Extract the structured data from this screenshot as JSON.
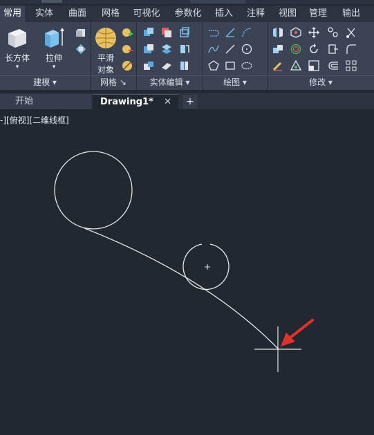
{
  "ribbon_tabs": [
    "常用",
    "实体",
    "曲面",
    "网格",
    "可视化",
    "参数化",
    "插入",
    "注释",
    "视图",
    "管理",
    "输出"
  ],
  "panels": {
    "modeling": {
      "title": "建模",
      "box_label": "长方体",
      "extrude_label": "拉伸"
    },
    "mesh": {
      "title": "网格",
      "smooth_label_1": "平滑",
      "smooth_label_2": "对象"
    },
    "solid_edit": {
      "title": "实体编辑"
    },
    "draw": {
      "title": "绘图"
    },
    "modify": {
      "title": "修改"
    }
  },
  "file_tabs": {
    "start": "开始",
    "doc": "Drawing1*",
    "close": "✕",
    "new": "+"
  },
  "viewport_label": "-][俯视][二维线框]",
  "colors": {
    "background": "#212830",
    "ribbon": "#3a4454",
    "accent_arrow": "#e0322a",
    "geometry": "#e8e8e8"
  },
  "icons": [
    "box-icon",
    "extrude-icon",
    "smooth-object-icon",
    "circle-icon",
    "arc-icon",
    "move-icon",
    "rotate-icon",
    "copy-icon",
    "mirror-icon",
    "fillet-icon",
    "array-icon",
    "crosshair-cursor-icon",
    "red-arrow-icon"
  ]
}
